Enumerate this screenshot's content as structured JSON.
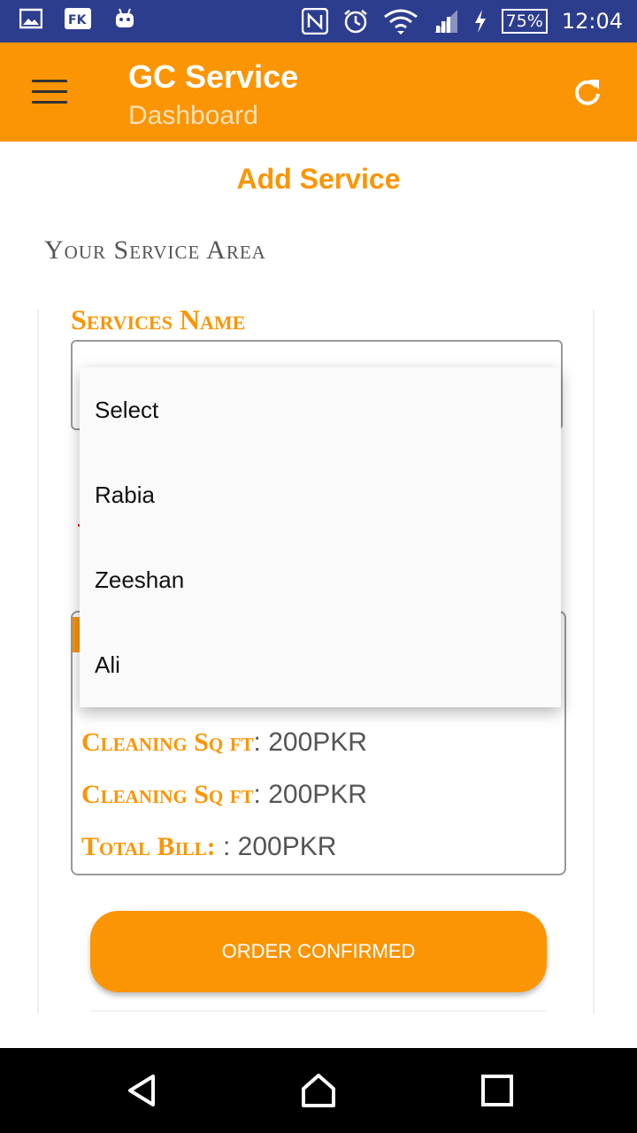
{
  "status_bar": {
    "time": "12:04",
    "battery": "75%",
    "icons": [
      "gallery-icon",
      "fk-app-icon",
      "android-icon",
      "nfc-icon",
      "alarm-icon",
      "wifi-icon",
      "signal-icon",
      "charging-icon"
    ]
  },
  "app_bar": {
    "title": "GC Service",
    "subtitle": "Dashboard",
    "accent_color": "#fb9504"
  },
  "page": {
    "heading": "Add Service",
    "section_title": "Your Service Area",
    "services_name_label": "Services Name"
  },
  "dropdown": {
    "options": [
      "Select",
      "Rabia",
      "Zeeshan",
      "Ali"
    ]
  },
  "summary": {
    "lines": [
      {
        "key": "Cleaning Sq ft",
        "value": ": 200PKR"
      },
      {
        "key": "Cleaning Sq ft",
        "value": ": 200PKR"
      },
      {
        "key": "Total Bill:",
        "value": " : 200PKR"
      }
    ]
  },
  "actions": {
    "confirm_label": "ORDER CONFIRMED"
  }
}
